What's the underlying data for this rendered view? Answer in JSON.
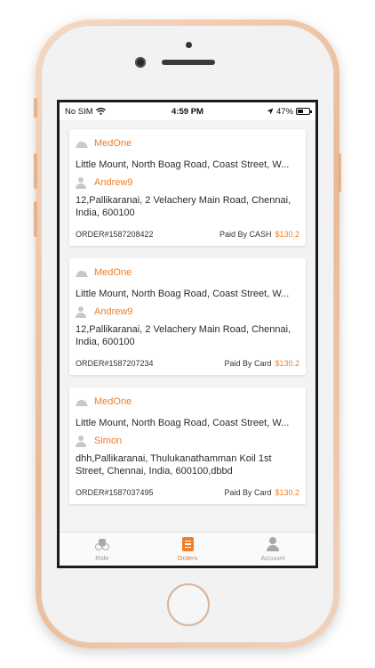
{
  "status_bar": {
    "carrier": "No SIM",
    "time": "4:59 PM",
    "battery": "47%",
    "battery_level": 0.47
  },
  "orders": [
    {
      "store": "MedOne",
      "pickup_address": "Little Mount, North Boag Road, Coast Street, W...",
      "customer": "Andrew9",
      "drop_address": "12,Pallikaranai, 2 Velachery Main Road, Chennai, India, 600100",
      "order_id": "ORDER#1587208422",
      "payment": "Paid By CASH",
      "amount": "$130.2"
    },
    {
      "store": "MedOne",
      "pickup_address": "Little Mount, North Boag Road, Coast Street, W...",
      "customer": "Andrew9",
      "drop_address": "12,Pallikaranai, 2 Velachery Main Road, Chennai, India, 600100",
      "order_id": "ORDER#1587207234",
      "payment": "Paid By Card",
      "amount": "$130.2"
    },
    {
      "store": "MedOne",
      "pickup_address": "Little Mount, North Boag Road, Coast Street, W...",
      "customer": "Simon",
      "drop_address": "dhh,Pallikaranai, Thulukanathamman Koil 1st Street, Chennai, India, 600100,dbbd",
      "order_id": "ORDER#1587037495",
      "payment": "Paid By Card",
      "amount": "$130.2"
    }
  ],
  "tabs": [
    {
      "label": "Ride",
      "icon": "ride-icon",
      "active": false
    },
    {
      "label": "Orders",
      "icon": "orders-icon",
      "active": true
    },
    {
      "label": "Account",
      "icon": "account-icon",
      "active": false
    }
  ],
  "colors": {
    "accent": "#f07e28",
    "phone_frame": "#e9b994",
    "text": "#2b2b2b",
    "muted_icon": "#c8c8c8"
  }
}
